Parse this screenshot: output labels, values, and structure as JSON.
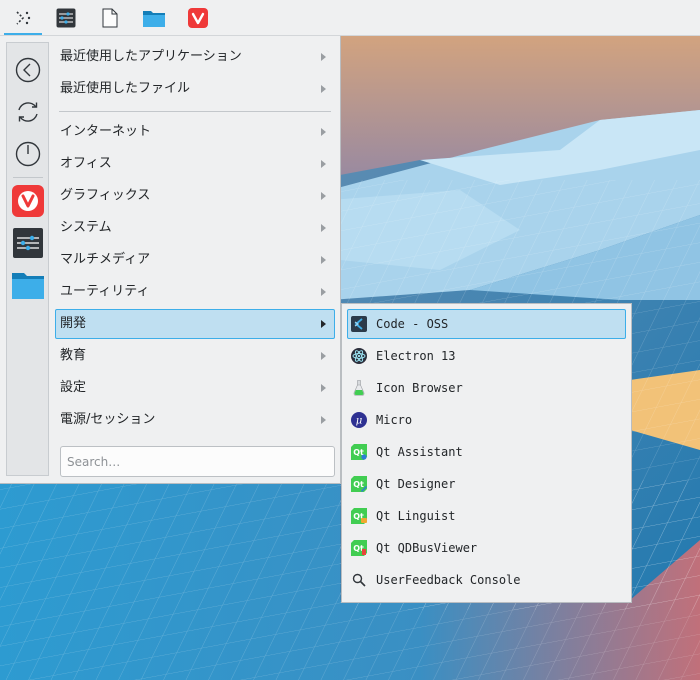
{
  "taskbar": {
    "launcher_icon": "kickoff-launcher-icon",
    "pinned": [
      {
        "name": "system-settings-icon"
      },
      {
        "name": "document-icon"
      },
      {
        "name": "folder-icon"
      },
      {
        "name": "vivaldi-icon"
      }
    ]
  },
  "sidebar": {
    "items": [
      {
        "name": "back-icon"
      },
      {
        "name": "refresh-icon"
      },
      {
        "name": "power-icon"
      },
      {
        "name": "vivaldi-icon"
      },
      {
        "name": "system-settings-icon"
      },
      {
        "name": "folder-icon"
      }
    ]
  },
  "menu": {
    "items": [
      {
        "label": "最近使用したアプリケーション"
      },
      {
        "label": "最近使用したファイル"
      },
      {
        "label": "インターネット"
      },
      {
        "label": "オフィス"
      },
      {
        "label": "グラフィックス"
      },
      {
        "label": "システム"
      },
      {
        "label": "マルチメディア"
      },
      {
        "label": "ユーティリティ"
      },
      {
        "label": "開発"
      },
      {
        "label": "教育"
      },
      {
        "label": "設定"
      },
      {
        "label": "電源/セッション"
      }
    ],
    "search_placeholder": "Search…"
  },
  "submenu": {
    "items": [
      {
        "label": "Code - OSS",
        "icon": "code-oss-icon"
      },
      {
        "label": "Electron 13",
        "icon": "electron-icon"
      },
      {
        "label": "Icon Browser",
        "icon": "icon-browser-icon"
      },
      {
        "label": "Micro",
        "icon": "micro-icon"
      },
      {
        "label": "Qt Assistant",
        "icon": "qt-assistant-icon"
      },
      {
        "label": "Qt Designer",
        "icon": "qt-designer-icon"
      },
      {
        "label": "Qt Linguist",
        "icon": "qt-linguist-icon"
      },
      {
        "label": "Qt QDBusViewer",
        "icon": "qt-qdbusviewer-icon"
      },
      {
        "label": "UserFeedback Console",
        "icon": "search-icon"
      }
    ]
  },
  "colors": {
    "accent": "#3daee9",
    "highlight": "#bfdff1",
    "panel": "#eff0f1",
    "vivaldi": "#ef3939",
    "qt_green": "#41cd52"
  }
}
